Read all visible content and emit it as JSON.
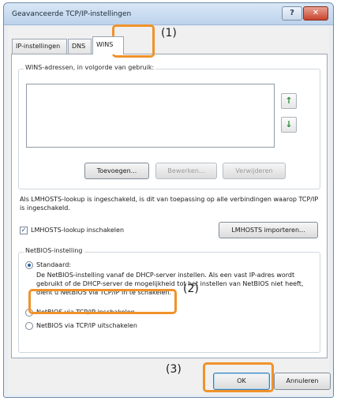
{
  "window": {
    "title": "Geavanceerde TCP/IP-instellingen",
    "help_label": "?",
    "close_label": "✕"
  },
  "tabs": [
    {
      "label": "IP-instellingen",
      "active": false
    },
    {
      "label": "DNS",
      "active": false
    },
    {
      "label": "WINS",
      "active": true
    }
  ],
  "wins": {
    "group_label": "WINS-adressen, in volgorde van gebruik:",
    "up_arrow": "↑",
    "down_arrow": "↓",
    "add_label": "Toevoegen...",
    "edit_label": "Bewerken...",
    "remove_label": "Verwijderen",
    "lmhosts_info": "Als LMHOSTS-lookup is ingeschakeld, is dit van toepassing op alle verbindingen waarop TCP/IP is ingeschakeld.",
    "lmhosts_checkbox_label": "LMHOSTS-lookup inschakelen",
    "lmhosts_checked": true,
    "lmhosts_import_label": "LMHOSTS importeren..."
  },
  "netbios": {
    "group_label": "NetBIOS-instelling",
    "options": [
      {
        "label": "Standaard:",
        "checked": true
      },
      {
        "label": "NetBIOS via TCP/IP inschakelen",
        "checked": false
      },
      {
        "label": "NetBIOS via TCP/IP uitschakelen",
        "checked": false
      }
    ],
    "default_description": "De NetBIOS-instelling vanaf de DHCP-server instellen. Als een vast IP-adres wordt gebruikt of de DHCP-server de mogelijkheid tot het instellen van NetBIOS niet heeft, dient u NetBIOS via TCP/IP in te schakelen."
  },
  "footer": {
    "ok_label": "OK",
    "cancel_label": "Annuleren"
  },
  "callouts": {
    "c1": "(1)",
    "c2": "(2)",
    "c3": "(3)"
  },
  "colors": {
    "highlight": "#f0922b",
    "close_button": "#c8432d",
    "arrow_green": "#2e8b3a"
  }
}
